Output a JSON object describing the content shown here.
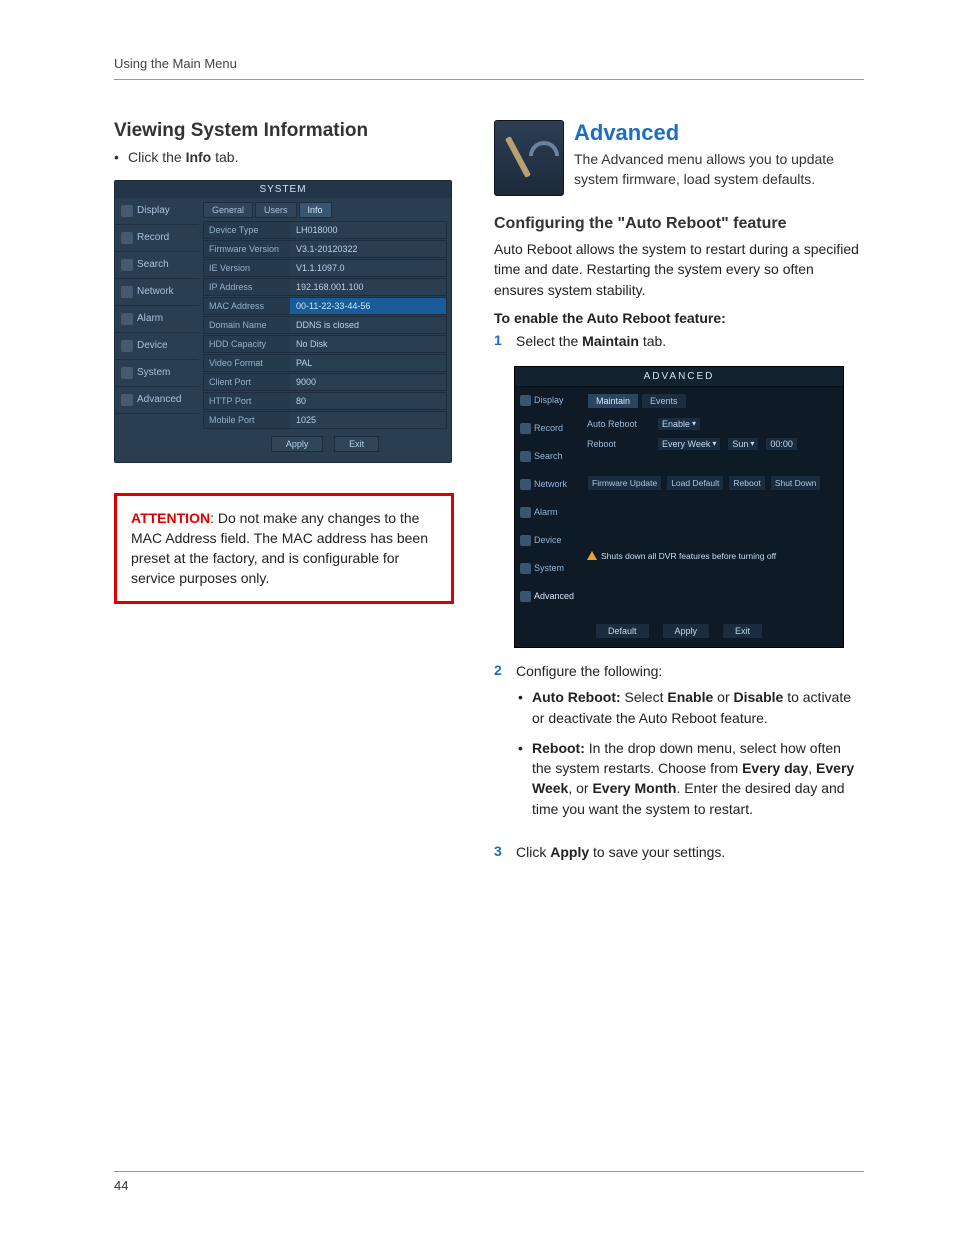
{
  "header": "Using the Main Menu",
  "page_number": "44",
  "left": {
    "heading": "Viewing System Information",
    "bullet_pre": "Click the ",
    "bullet_bold": "Info",
    "bullet_post": " tab.",
    "attention_label": "ATTENTION",
    "attention_text": ": Do not make any changes to the MAC Address field. The MAC address has been preset at the factory, and is configurable for service purposes only."
  },
  "system_shot": {
    "title": "SYSTEM",
    "side": [
      "Display",
      "Record",
      "Search",
      "Network",
      "Alarm",
      "Device",
      "System",
      "Advanced"
    ],
    "tabs": [
      "General",
      "Users",
      "Info"
    ],
    "active_tab": 2,
    "rows": [
      {
        "k": "Device Type",
        "v": "LH018000"
      },
      {
        "k": "Firmware Version",
        "v": "V3.1-20120322"
      },
      {
        "k": "IE Version",
        "v": "V1.1.1097.0"
      },
      {
        "k": "IP Address",
        "v": "192.168.001.100"
      },
      {
        "k": "MAC Address",
        "v": "00-11-22-33-44-56",
        "sel": true
      },
      {
        "k": "Domain Name",
        "v": "DDNS is closed"
      },
      {
        "k": "HDD Capacity",
        "v": "No Disk"
      },
      {
        "k": "Video Format",
        "v": "PAL"
      },
      {
        "k": "Client Port",
        "v": "9000"
      },
      {
        "k": "HTTP Port",
        "v": "80"
      },
      {
        "k": "Mobile Port",
        "v": "1025"
      }
    ],
    "btns": [
      "Apply",
      "Exit"
    ]
  },
  "right": {
    "heading": "Advanced",
    "intro": "The Advanced menu allows you to update system firmware, load system defaults.",
    "sub_heading": "Configuring the \"Auto Reboot\" feature",
    "sub_intro": "Auto Reboot allows the system to restart during a specified time and date. Restarting the system every so often ensures system stability.",
    "enable_head": "To enable the Auto Reboot feature:",
    "step1_pre": "Select the ",
    "step1_bold": "Maintain",
    "step1_post": " tab.",
    "step2": "Configure the following:",
    "step2a_label": "Auto Reboot:",
    "step2a_mid": " Select ",
    "step2a_b1": "Enable",
    "step2a_or": " or ",
    "step2a_b2": "Disable",
    "step2a_post": " to activate or deactivate the Auto Reboot feature.",
    "step2b_label": "Reboot:",
    "step2b_mid": " In the drop down menu, select how often the system restarts. Choose from ",
    "step2b_b1": "Every day",
    "step2b_c1": ", ",
    "step2b_b2": "Every Week",
    "step2b_c2": ", or ",
    "step2b_b3": "Every Month",
    "step2b_post": ". Enter the desired day and time you want the system to restart.",
    "step3_pre": "Click ",
    "step3_bold": "Apply",
    "step3_post": " to save your settings."
  },
  "adv_shot": {
    "title": "ADVANCED",
    "side": [
      "Display",
      "Record",
      "Search",
      "Network",
      "Alarm",
      "Device",
      "System",
      "Advanced"
    ],
    "tabs": [
      "Maintain",
      "Events"
    ],
    "row1_label": "Auto Reboot",
    "row1_value": "Enable",
    "row2_label": "Reboot",
    "row2_v1": "Every Week",
    "row2_v2": "Sun",
    "row2_v3": "00:00",
    "action_btns": [
      "Firmware Update",
      "Load Default",
      "Reboot",
      "Shut Down"
    ],
    "warn": "Shuts down all DVR features before turning off",
    "bot": [
      "Default",
      "Apply",
      "Exit"
    ]
  }
}
